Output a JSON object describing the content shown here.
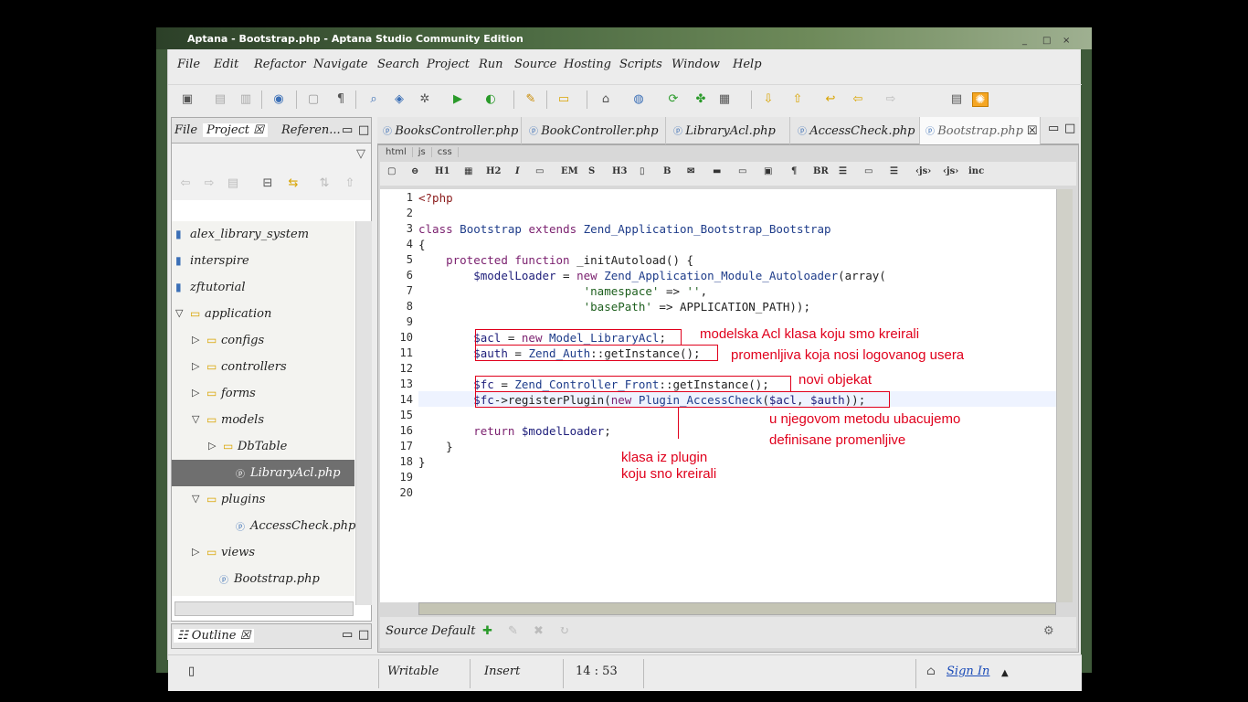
{
  "window": {
    "title": "Aptana - Bootstrap.php - Aptana Studio Community Edition"
  },
  "menu": [
    "File",
    "Edit",
    "Refactor",
    "Navigate",
    "Search",
    "Project",
    "Run",
    "Source",
    "Hosting",
    "Scripts",
    "Window",
    "Help"
  ],
  "left_panel": {
    "tabs": [
      "File",
      "Project",
      "Referen..."
    ],
    "tree": [
      {
        "label": "alex_library_system",
        "indent": 0,
        "icon": "project-icon"
      },
      {
        "label": "interspire",
        "indent": 0,
        "icon": "project-icon"
      },
      {
        "label": "zftutorial",
        "indent": 0,
        "icon": "project-icon"
      },
      {
        "label": "application",
        "indent": 0,
        "icon": "folder-icon",
        "expanded": true
      },
      {
        "label": "configs",
        "indent": 1,
        "icon": "folder-icon"
      },
      {
        "label": "controllers",
        "indent": 1,
        "icon": "folder-icon"
      },
      {
        "label": "forms",
        "indent": 1,
        "icon": "folder-icon"
      },
      {
        "label": "models",
        "indent": 1,
        "icon": "folder-icon",
        "expanded": true
      },
      {
        "label": "DbTable",
        "indent": 2,
        "icon": "folder-icon"
      },
      {
        "label": "LibraryAcl.php",
        "indent": 2,
        "icon": "php-file-icon",
        "selected": true
      },
      {
        "label": "plugins",
        "indent": 1,
        "icon": "folder-icon",
        "expanded": true
      },
      {
        "label": "AccessCheck.php",
        "indent": 2,
        "icon": "php-file-icon"
      },
      {
        "label": "views",
        "indent": 1,
        "icon": "folder-icon"
      },
      {
        "label": "Bootstrap.php",
        "indent": 1,
        "icon": "php-file-icon"
      }
    ],
    "outline_tab": "Outline"
  },
  "editor": {
    "tabs": [
      "BooksController.php",
      "BookController.php",
      "LibraryAcl.php",
      "AccessCheck.php",
      "Bootstrap.php"
    ],
    "active_tab": "Bootstrap.php",
    "subtabs": [
      "html",
      "js",
      "css"
    ],
    "html_toolbar": [
      "H1",
      "H2",
      "I",
      "EM",
      "S",
      "H3",
      "B",
      "¶",
      "BR"
    ],
    "line_numbers": [
      "1",
      "2",
      "3",
      "4",
      "5",
      "6",
      "7",
      "8",
      "9",
      "10",
      "11",
      "12",
      "13",
      "14",
      "15",
      "16",
      "17",
      "18",
      "19",
      "20"
    ],
    "bottom_tabs": [
      "Source",
      "Default"
    ]
  },
  "annotations": {
    "a1": "modelska Acl klasa koju smo kreirali",
    "a2": "promenljiva koja nosi logovanog usera",
    "a3": "novi objekat",
    "a4_line1": "u njegovom metodu ubacujemo",
    "a4_line2": "definisane promenljive",
    "a5_line1": "klasa iz plugin",
    "a5_line2": "koju sno kreirali"
  },
  "status": {
    "mode": "Writable",
    "insert": "Insert",
    "position": "14 : 53",
    "sign_in": "Sign In"
  }
}
